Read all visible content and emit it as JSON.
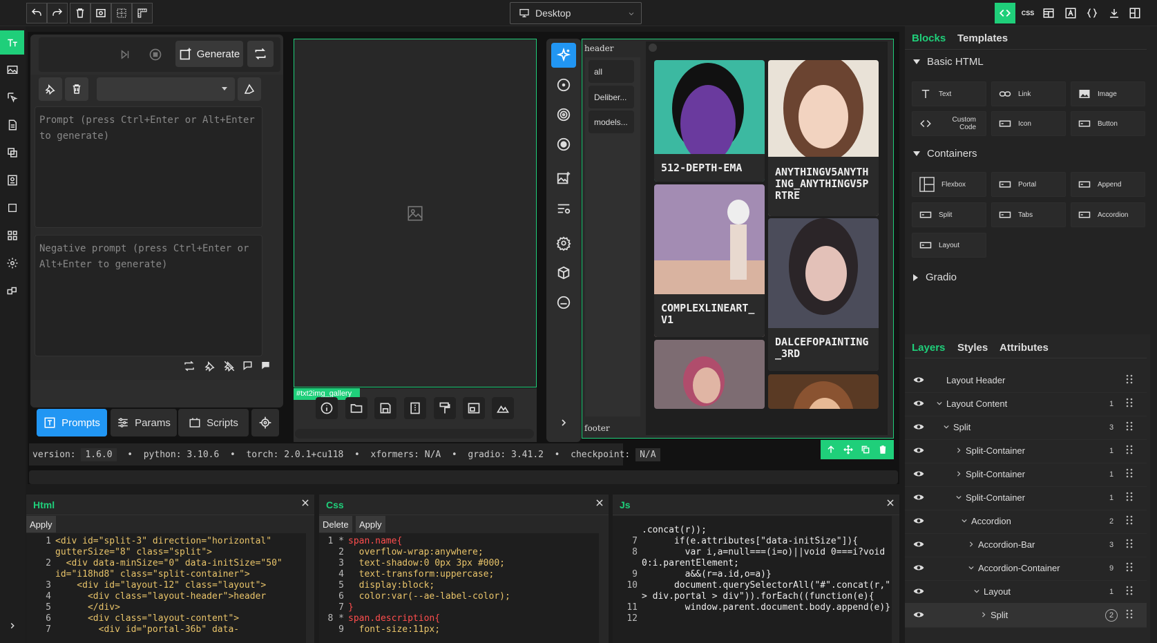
{
  "device": {
    "label": "Desktop"
  },
  "topbar": {
    "left_icons": [
      "undo-icon",
      "redo-icon",
      "trash-icon",
      "preview-icon",
      "grid-icon",
      "ruler-icon"
    ],
    "right_icons": [
      "code-view-icon",
      "css-icon",
      "layers-icon",
      "text-icon",
      "braces-icon",
      "download-icon",
      "split-view-icon"
    ],
    "css_label": "CSS"
  },
  "left": {
    "generate_label": "Generate",
    "prompt_placeholder": "Prompt (press Ctrl+Enter or Alt+Enter to generate)",
    "negative_placeholder": "Negative prompt (press Ctrl+Enter or Alt+Enter to generate)",
    "tabs": [
      {
        "label": "Prompts"
      },
      {
        "label": "Params"
      },
      {
        "label": "Scripts"
      }
    ]
  },
  "gallery_tag": "#txt2img_gallery",
  "models": {
    "header": "header",
    "footer": "footer",
    "chips": [
      "all",
      "Deliber...",
      "models..."
    ],
    "tiles": [
      "512-DEPTH-EMA",
      "ANYTHINGV5ANYTHING_ANYTHINGV5PRTRE",
      "COMPLEXLINEART_V1",
      "DALCEFOPAINTING_3RD"
    ]
  },
  "status": {
    "version_label": "version:",
    "version": "1.6.0",
    "python_label": "python:",
    "python": "3.10.6",
    "torch_label": "torch:",
    "torch": "2.0.1+cu118",
    "xformers_label": "xformers:",
    "xformers": "N/A",
    "gradio_label": "gradio:",
    "gradio": "3.41.2",
    "checkpoint_label": "checkpoint:",
    "checkpoint": "N/A"
  },
  "editors": {
    "html": {
      "title": "Html",
      "apply": "Apply"
    },
    "css": {
      "title": "Css",
      "delete": "Delete",
      "apply": "Apply"
    },
    "js": {
      "title": "Js"
    }
  },
  "html_lines": [
    {
      "n": "1",
      "t": "<div id=\"split-3\" direction=\"horizontal\""
    },
    {
      "n": "",
      "t": "gutterSize=\"8\" class=\"split\">"
    },
    {
      "n": "2",
      "t": "  <div data-minSize=\"0\" data-initSize=\"50\""
    },
    {
      "n": "",
      "t": "id=\"i18hd8\" class=\"split-container\">"
    },
    {
      "n": "3",
      "t": "    <div id=\"layout-12\" class=\"layout\">"
    },
    {
      "n": "4",
      "t": "      <div class=\"layout-header\">header"
    },
    {
      "n": "5",
      "t": "      </div>"
    },
    {
      "n": "6",
      "t": "      <div class=\"layout-content\">"
    },
    {
      "n": "7",
      "t": "        <div id=\"portal-36b\" data-"
    }
  ],
  "css_lines": [
    {
      "n": "1 *",
      "t": "span.name{"
    },
    {
      "n": "2",
      "t": "  overflow-wrap:anywhere;"
    },
    {
      "n": "3",
      "t": "  text-shadow:0 0px 3px #000;"
    },
    {
      "n": "4",
      "t": "  text-transform:uppercase;"
    },
    {
      "n": "5",
      "t": "  display:block;"
    },
    {
      "n": "6",
      "t": "  color:var(--ae-label-color);"
    },
    {
      "n": "7",
      "t": "}"
    },
    {
      "n": "8 *",
      "t": "span.description{"
    },
    {
      "n": "9",
      "t": "  font-size:11px;"
    }
  ],
  "js_lines": [
    {
      "n": "",
      "t": ".concat(r));"
    },
    {
      "n": "7",
      "t": "      if(e.attributes[\"data-initSize\"]){"
    },
    {
      "n": "8",
      "t": "        var i,a=null===(i=o)||void 0===i?void"
    },
    {
      "n": "",
      "t": "0:i.parentElement;"
    },
    {
      "n": "9",
      "t": "        a&&(r=a.id,o=a)}"
    },
    {
      "n": "10",
      "t": "      document.querySelectorAll(\"#\".concat(r,\""
    },
    {
      "n": "",
      "t": "> div.portal > div\")).forEach((function(e){"
    },
    {
      "n": "11",
      "t": "        window.parent.document.body.append(e)}"
    },
    {
      "n": "12",
      "t": ""
    }
  ],
  "sidebar": {
    "tab_blocks": "Blocks",
    "tab_templates": "Templates",
    "basic_html": "Basic HTML",
    "containers": "Containers",
    "gradio": "Gradio",
    "blocks_basic": [
      {
        "label": "Text"
      },
      {
        "label": "Link"
      },
      {
        "label": "Image"
      },
      {
        "label": "Custom Code"
      },
      {
        "label": "Icon"
      },
      {
        "label": "Button"
      }
    ],
    "blocks_containers": [
      {
        "label": "Flexbox"
      },
      {
        "label": "Portal"
      },
      {
        "label": "Append"
      },
      {
        "label": "Split"
      },
      {
        "label": "Tabs"
      },
      {
        "label": "Accordion"
      },
      {
        "label": "Layout"
      }
    ],
    "tab_layers": "Layers",
    "tab_styles": "Styles",
    "tab_attributes": "Attributes",
    "layers": [
      {
        "name": "Layout Header",
        "count": ""
      },
      {
        "name": "Layout Content",
        "count": "1"
      },
      {
        "name": "Split",
        "count": "3"
      },
      {
        "name": "Split-Container",
        "count": "1"
      },
      {
        "name": "Split-Container",
        "count": "1"
      },
      {
        "name": "Split-Container",
        "count": "1"
      },
      {
        "name": "Accordion",
        "count": "2"
      },
      {
        "name": "Accordion-Bar",
        "count": "3"
      },
      {
        "name": "Accordion-Container",
        "count": "9"
      },
      {
        "name": "Layout",
        "count": "1"
      },
      {
        "name": "Split",
        "count": "2"
      }
    ]
  },
  "colors": {
    "accent": "#1fcf7a",
    "blue": "#2196f3",
    "bg": "#1b1b1b"
  }
}
